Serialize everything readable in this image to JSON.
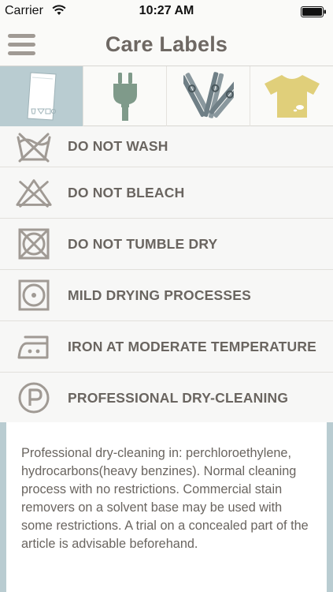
{
  "status_bar": {
    "carrier": "Carrier",
    "time": "10:27 AM"
  },
  "nav": {
    "title": "Care Labels",
    "menu_icon": "hamburger-menu-icon"
  },
  "tabs": [
    {
      "icon": "care-tag-icon",
      "active": true
    },
    {
      "icon": "power-plug-icon",
      "active": false
    },
    {
      "icon": "clothespins-icon",
      "active": false
    },
    {
      "icon": "stained-tshirt-icon",
      "active": false
    }
  ],
  "labels": [
    {
      "icon": "do-not-wash-icon",
      "text": "DO NOT WASH"
    },
    {
      "icon": "do-not-bleach-icon",
      "text": "DO NOT BLEACH"
    },
    {
      "icon": "do-not-tumble-dry-icon",
      "text": "DO NOT TUMBLE DRY"
    },
    {
      "icon": "mild-drying-icon",
      "text": "MILD DRYING PROCESSES"
    },
    {
      "icon": "iron-moderate-icon",
      "text": "IRON AT MODERATE TEMPERATURE"
    },
    {
      "icon": "professional-dry-cleaning-icon",
      "text": "PROFESSIONAL DRY-CLEANING"
    }
  ],
  "detail": {
    "text": "Professional dry-cleaning in: perchloroethylene, hydrocarbons(heavy benzines). Normal cleaning process with no restrictions. Commercial stain removers on a solvent base may be used with some restrictions. A trial on a concealed part of the article is advisable beforehand."
  },
  "colors": {
    "accent_blue": "#b9ccd1",
    "icon_gray": "#a09a94",
    "plug_green": "#7f9a8a",
    "pin_slate": "#6f7f86",
    "shirt_yellow": "#e0cf7a",
    "text": "#6a6560"
  }
}
